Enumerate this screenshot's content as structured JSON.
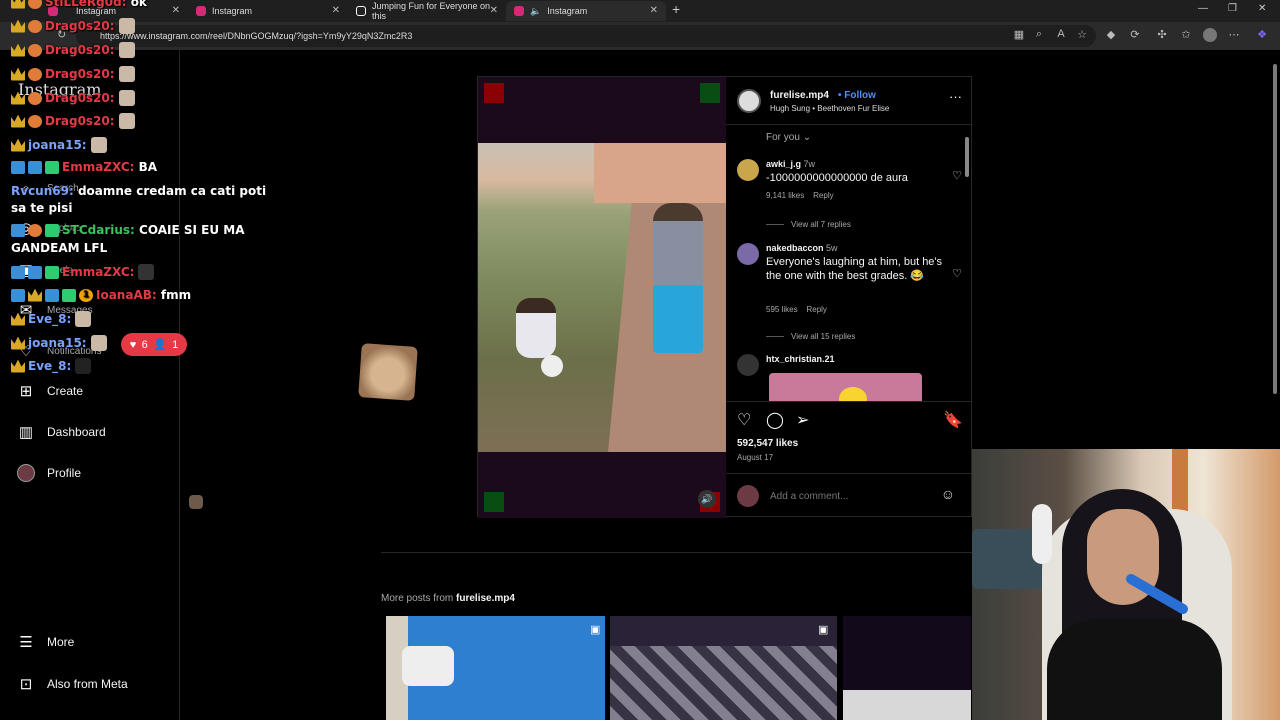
{
  "browser": {
    "tabs": [
      {
        "title": "Instagram",
        "icon_color": "#d62976",
        "active": false
      },
      {
        "title": "Jumping Fun for Everyone on this",
        "icon_color": "#ffffff",
        "active": false
      },
      {
        "title": "Instagram",
        "icon_color": "#d62976",
        "active": true
      }
    ],
    "url": "https://www.instagram.com/reel/DNbnGOGMzuq/?igsh=Ym9yY29qN3Zmc2R3",
    "new_tab_icon": "plus-icon"
  },
  "sidebar": {
    "logo": "Instagram",
    "items": [
      {
        "label": "Search",
        "icon": "search-icon"
      },
      {
        "label": "Explore",
        "icon": "compass-icon"
      },
      {
        "label": "Reels",
        "icon": "reels-icon"
      },
      {
        "label": "Messages",
        "icon": "messenger-icon"
      },
      {
        "label": "Notifications",
        "icon": "heart-icon"
      },
      {
        "label": "Create",
        "icon": "plus-square-icon"
      },
      {
        "label": "Dashboard",
        "icon": "bar-chart-icon"
      },
      {
        "label": "Profile",
        "icon": "avatar"
      },
      {
        "label": "More",
        "icon": "menu-icon"
      },
      {
        "label": "Also from Meta",
        "icon": "grid-icon"
      }
    ],
    "notification_pill": {
      "likes": "6",
      "follows": "1",
      "color": "#e63946"
    }
  },
  "chat": [
    {
      "user": "StiLLeRg0d:",
      "message": "ok",
      "user_color": "#e63946"
    },
    {
      "user": "Drag0s20:",
      "message": "",
      "user_color": "#e63946"
    },
    {
      "user": "Drag0s20:",
      "message": "",
      "user_color": "#e63946"
    },
    {
      "user": "Drag0s20:",
      "message": "",
      "user_color": "#e63946"
    },
    {
      "user": "Drag0s20:",
      "message": "",
      "user_color": "#e63946"
    },
    {
      "user": "Drag0s20:",
      "message": "",
      "user_color": "#e63946"
    },
    {
      "user": "joana15:",
      "message": "",
      "user_color": "#7aa2ff"
    },
    {
      "user": "EmmaZXC:",
      "message": "BA",
      "user_color": "#e63946"
    },
    {
      "user": "Rvcun69:",
      "message": "doamne credam ca cati poti",
      "user_color": "#7aa2ff"
    },
    {
      "user": "",
      "message": "sa te pisi",
      "user_color": "#ffffff"
    },
    {
      "user": "STCdarius:",
      "message": "COAIE SI EU MA",
      "user_color": "#3fbf5f"
    },
    {
      "user": "",
      "message": "GANDEAM LFL",
      "user_color": "#ffffff"
    },
    {
      "user": "EmmaZXC:",
      "message": "",
      "user_color": "#e63946"
    },
    {
      "user": "IoanaAB:",
      "message": "fmm",
      "user_color": "#e63946"
    },
    {
      "user": "Eve_8:",
      "message": "",
      "user_color": "#7aa2ff"
    },
    {
      "user": "joana15:",
      "message": "",
      "user_color": "#7aa2ff"
    },
    {
      "user": "Eve_8:",
      "message": "",
      "user_color": "#7aa2ff"
    }
  ],
  "post": {
    "author": "furelise.mp4",
    "follow_label": "Follow",
    "audio": "Hugh Sung • Beethoven Fur Elise",
    "sort_label": "For you",
    "comments": [
      {
        "user": "awki_j.g",
        "time": "7w",
        "text": "-1000000000000000 de aura",
        "likes": "9,141 likes",
        "reply": "Reply",
        "view_replies": "View all 7 replies"
      },
      {
        "user": "nakedbaccon",
        "time": "5w",
        "text": "Everyone's laughing at him, but he's the one with the best grades. 😂",
        "likes": "595 likes",
        "reply": "Reply",
        "view_replies": "View all 15 replies"
      },
      {
        "user": "htx_christian.21",
        "time": "",
        "text": "",
        "likes": "",
        "reply": "",
        "view_replies": ""
      }
    ],
    "likes": "592,547 likes",
    "date": "August 17",
    "comment_placeholder": "Add a comment..."
  },
  "more_posts": {
    "prefix": "More posts from",
    "author": "furelise.mp4"
  }
}
